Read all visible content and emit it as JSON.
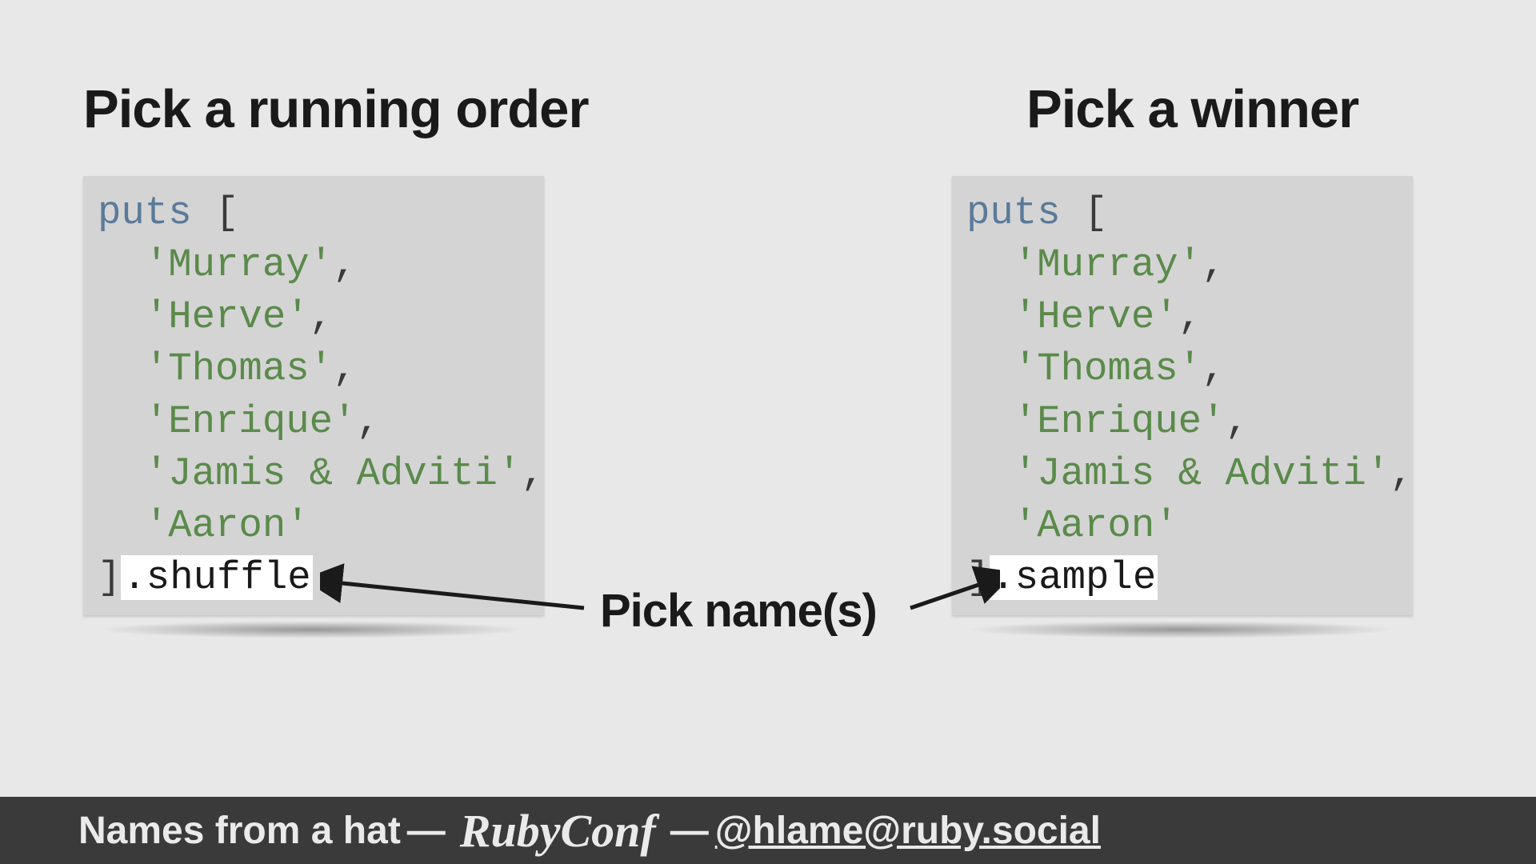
{
  "headings": {
    "left": "Pick a running order",
    "right": "Pick a winner"
  },
  "code": {
    "keyword": "puts",
    "open": " [",
    "items": [
      "'Murray'",
      "'Herve'",
      "'Thomas'",
      "'Enrique'",
      "'Jamis & Adviti'",
      "'Aaron'"
    ],
    "close": "]",
    "left_method": ".shuffle",
    "right_method": ".sample"
  },
  "center_label": "Pick name(s)",
  "footer": {
    "title": "Names from a hat",
    "sep": "—",
    "event": "RubyConf",
    "handle": "@hlame@ruby.social"
  }
}
